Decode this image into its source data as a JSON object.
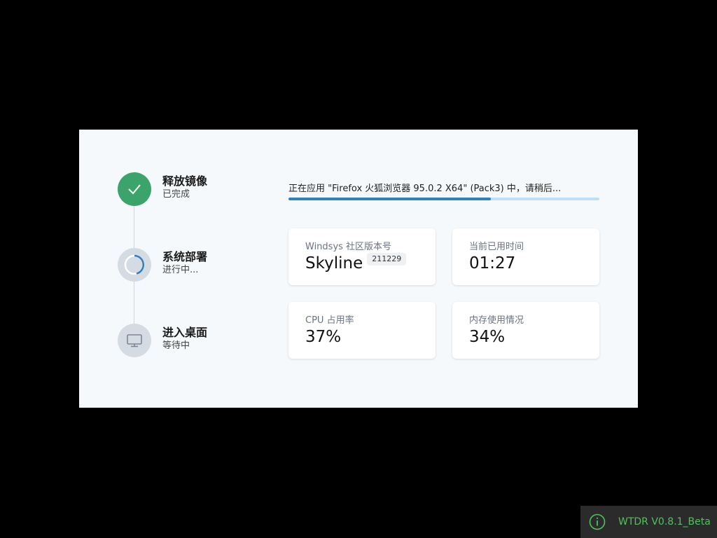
{
  "steps": [
    {
      "title": "释放镜像",
      "status": "已完成",
      "state": "done",
      "icon": "check-icon"
    },
    {
      "title": "系统部署",
      "status": "进行中...",
      "state": "in-progress",
      "icon": "spinner-icon"
    },
    {
      "title": "进入桌面",
      "status": "等待中",
      "state": "waiting",
      "icon": "monitor-icon"
    }
  ],
  "progress": {
    "message": "正在应用 \"Firefox 火狐浏览器 95.0.2 X64\" (Pack3) 中，请稍后...",
    "percent": 65
  },
  "cards": {
    "version": {
      "label": "Windsys 社区版本号",
      "value": "Skyline",
      "badge": "211229"
    },
    "elapsed": {
      "label": "当前已用时间",
      "value": "01:27"
    },
    "cpu": {
      "label": "CPU 占用率",
      "value": "37%"
    },
    "memory": {
      "label": "内存使用情况",
      "value": "34%"
    }
  },
  "version_tag": {
    "text": "WTDR V0.8.1_Beta",
    "icon": "info-icon"
  },
  "colors": {
    "done": "#3aa46a",
    "accent": "#2f7fc1",
    "track": "#bfe0f7",
    "version_text": "#4fc35a"
  }
}
